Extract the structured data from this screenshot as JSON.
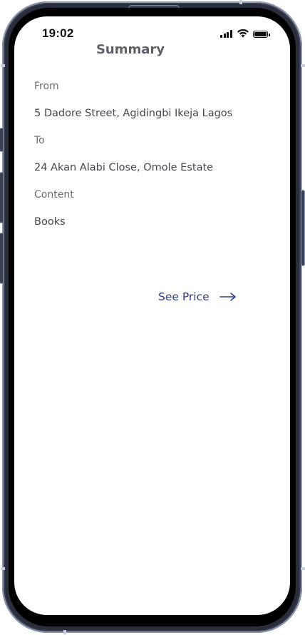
{
  "status_bar": {
    "time": "19:02",
    "icons": [
      "cellular-signal-icon",
      "wifi-icon",
      "battery-icon"
    ]
  },
  "header": {
    "title": "Summary"
  },
  "summary": {
    "from_label": "From",
    "from_value": "5 Dadore Street, Agidingbi Ikeja Lagos",
    "to_label": "To",
    "to_value": "24 Akan Alabi Close, Omole Estate",
    "content_label": "Content",
    "content_value": "Books"
  },
  "actions": {
    "see_price_label": "See Price",
    "see_price_icon": "arrow-right-icon"
  },
  "colors": {
    "accent": "#2e3a8c",
    "title": "#5f6068",
    "label": "#6c6d74",
    "value": "#45464d"
  }
}
